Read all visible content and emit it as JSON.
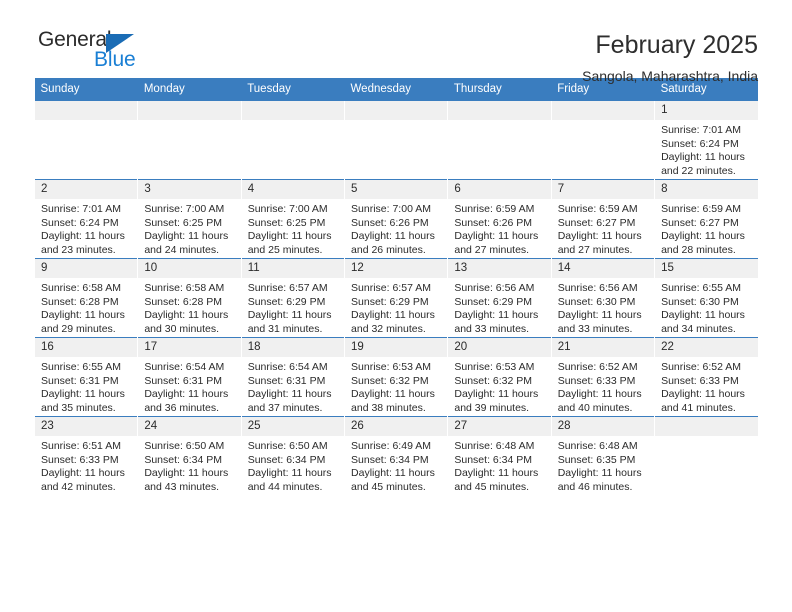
{
  "brand": {
    "name_top": "General",
    "name_bottom": "Blue",
    "accent_color": "#1a7fd4",
    "triangle_color": "#1a6cb5",
    "triangle_icon": "triangle-icon"
  },
  "header": {
    "title": "February 2025",
    "subtitle": "Sangola, Maharashtra, India"
  },
  "calendar": {
    "header_bg": "#3a7dbf",
    "daynum_bg": "#f0f0f0",
    "weekdays": [
      "Sunday",
      "Monday",
      "Tuesday",
      "Wednesday",
      "Thursday",
      "Friday",
      "Saturday"
    ],
    "weeks": [
      [
        {
          "day": "",
          "empty": true
        },
        {
          "day": "",
          "empty": true
        },
        {
          "day": "",
          "empty": true
        },
        {
          "day": "",
          "empty": true
        },
        {
          "day": "",
          "empty": true
        },
        {
          "day": "",
          "empty": true
        },
        {
          "day": "1",
          "sunrise": "Sunrise: 7:01 AM",
          "sunset": "Sunset: 6:24 PM",
          "daylight": "Daylight: 11 hours and 22 minutes."
        }
      ],
      [
        {
          "day": "2",
          "sunrise": "Sunrise: 7:01 AM",
          "sunset": "Sunset: 6:24 PM",
          "daylight": "Daylight: 11 hours and 23 minutes."
        },
        {
          "day": "3",
          "sunrise": "Sunrise: 7:00 AM",
          "sunset": "Sunset: 6:25 PM",
          "daylight": "Daylight: 11 hours and 24 minutes."
        },
        {
          "day": "4",
          "sunrise": "Sunrise: 7:00 AM",
          "sunset": "Sunset: 6:25 PM",
          "daylight": "Daylight: 11 hours and 25 minutes."
        },
        {
          "day": "5",
          "sunrise": "Sunrise: 7:00 AM",
          "sunset": "Sunset: 6:26 PM",
          "daylight": "Daylight: 11 hours and 26 minutes."
        },
        {
          "day": "6",
          "sunrise": "Sunrise: 6:59 AM",
          "sunset": "Sunset: 6:26 PM",
          "daylight": "Daylight: 11 hours and 27 minutes."
        },
        {
          "day": "7",
          "sunrise": "Sunrise: 6:59 AM",
          "sunset": "Sunset: 6:27 PM",
          "daylight": "Daylight: 11 hours and 27 minutes."
        },
        {
          "day": "8",
          "sunrise": "Sunrise: 6:59 AM",
          "sunset": "Sunset: 6:27 PM",
          "daylight": "Daylight: 11 hours and 28 minutes."
        }
      ],
      [
        {
          "day": "9",
          "sunrise": "Sunrise: 6:58 AM",
          "sunset": "Sunset: 6:28 PM",
          "daylight": "Daylight: 11 hours and 29 minutes."
        },
        {
          "day": "10",
          "sunrise": "Sunrise: 6:58 AM",
          "sunset": "Sunset: 6:28 PM",
          "daylight": "Daylight: 11 hours and 30 minutes."
        },
        {
          "day": "11",
          "sunrise": "Sunrise: 6:57 AM",
          "sunset": "Sunset: 6:29 PM",
          "daylight": "Daylight: 11 hours and 31 minutes."
        },
        {
          "day": "12",
          "sunrise": "Sunrise: 6:57 AM",
          "sunset": "Sunset: 6:29 PM",
          "daylight": "Daylight: 11 hours and 32 minutes."
        },
        {
          "day": "13",
          "sunrise": "Sunrise: 6:56 AM",
          "sunset": "Sunset: 6:29 PM",
          "daylight": "Daylight: 11 hours and 33 minutes."
        },
        {
          "day": "14",
          "sunrise": "Sunrise: 6:56 AM",
          "sunset": "Sunset: 6:30 PM",
          "daylight": "Daylight: 11 hours and 33 minutes."
        },
        {
          "day": "15",
          "sunrise": "Sunrise: 6:55 AM",
          "sunset": "Sunset: 6:30 PM",
          "daylight": "Daylight: 11 hours and 34 minutes."
        }
      ],
      [
        {
          "day": "16",
          "sunrise": "Sunrise: 6:55 AM",
          "sunset": "Sunset: 6:31 PM",
          "daylight": "Daylight: 11 hours and 35 minutes."
        },
        {
          "day": "17",
          "sunrise": "Sunrise: 6:54 AM",
          "sunset": "Sunset: 6:31 PM",
          "daylight": "Daylight: 11 hours and 36 minutes."
        },
        {
          "day": "18",
          "sunrise": "Sunrise: 6:54 AM",
          "sunset": "Sunset: 6:31 PM",
          "daylight": "Daylight: 11 hours and 37 minutes."
        },
        {
          "day": "19",
          "sunrise": "Sunrise: 6:53 AM",
          "sunset": "Sunset: 6:32 PM",
          "daylight": "Daylight: 11 hours and 38 minutes."
        },
        {
          "day": "20",
          "sunrise": "Sunrise: 6:53 AM",
          "sunset": "Sunset: 6:32 PM",
          "daylight": "Daylight: 11 hours and 39 minutes."
        },
        {
          "day": "21",
          "sunrise": "Sunrise: 6:52 AM",
          "sunset": "Sunset: 6:33 PM",
          "daylight": "Daylight: 11 hours and 40 minutes."
        },
        {
          "day": "22",
          "sunrise": "Sunrise: 6:52 AM",
          "sunset": "Sunset: 6:33 PM",
          "daylight": "Daylight: 11 hours and 41 minutes."
        }
      ],
      [
        {
          "day": "23",
          "sunrise": "Sunrise: 6:51 AM",
          "sunset": "Sunset: 6:33 PM",
          "daylight": "Daylight: 11 hours and 42 minutes."
        },
        {
          "day": "24",
          "sunrise": "Sunrise: 6:50 AM",
          "sunset": "Sunset: 6:34 PM",
          "daylight": "Daylight: 11 hours and 43 minutes."
        },
        {
          "day": "25",
          "sunrise": "Sunrise: 6:50 AM",
          "sunset": "Sunset: 6:34 PM",
          "daylight": "Daylight: 11 hours and 44 minutes."
        },
        {
          "day": "26",
          "sunrise": "Sunrise: 6:49 AM",
          "sunset": "Sunset: 6:34 PM",
          "daylight": "Daylight: 11 hours and 45 minutes."
        },
        {
          "day": "27",
          "sunrise": "Sunrise: 6:48 AM",
          "sunset": "Sunset: 6:34 PM",
          "daylight": "Daylight: 11 hours and 45 minutes."
        },
        {
          "day": "28",
          "sunrise": "Sunrise: 6:48 AM",
          "sunset": "Sunset: 6:35 PM",
          "daylight": "Daylight: 11 hours and 46 minutes."
        },
        {
          "day": "",
          "empty": true
        }
      ]
    ]
  }
}
